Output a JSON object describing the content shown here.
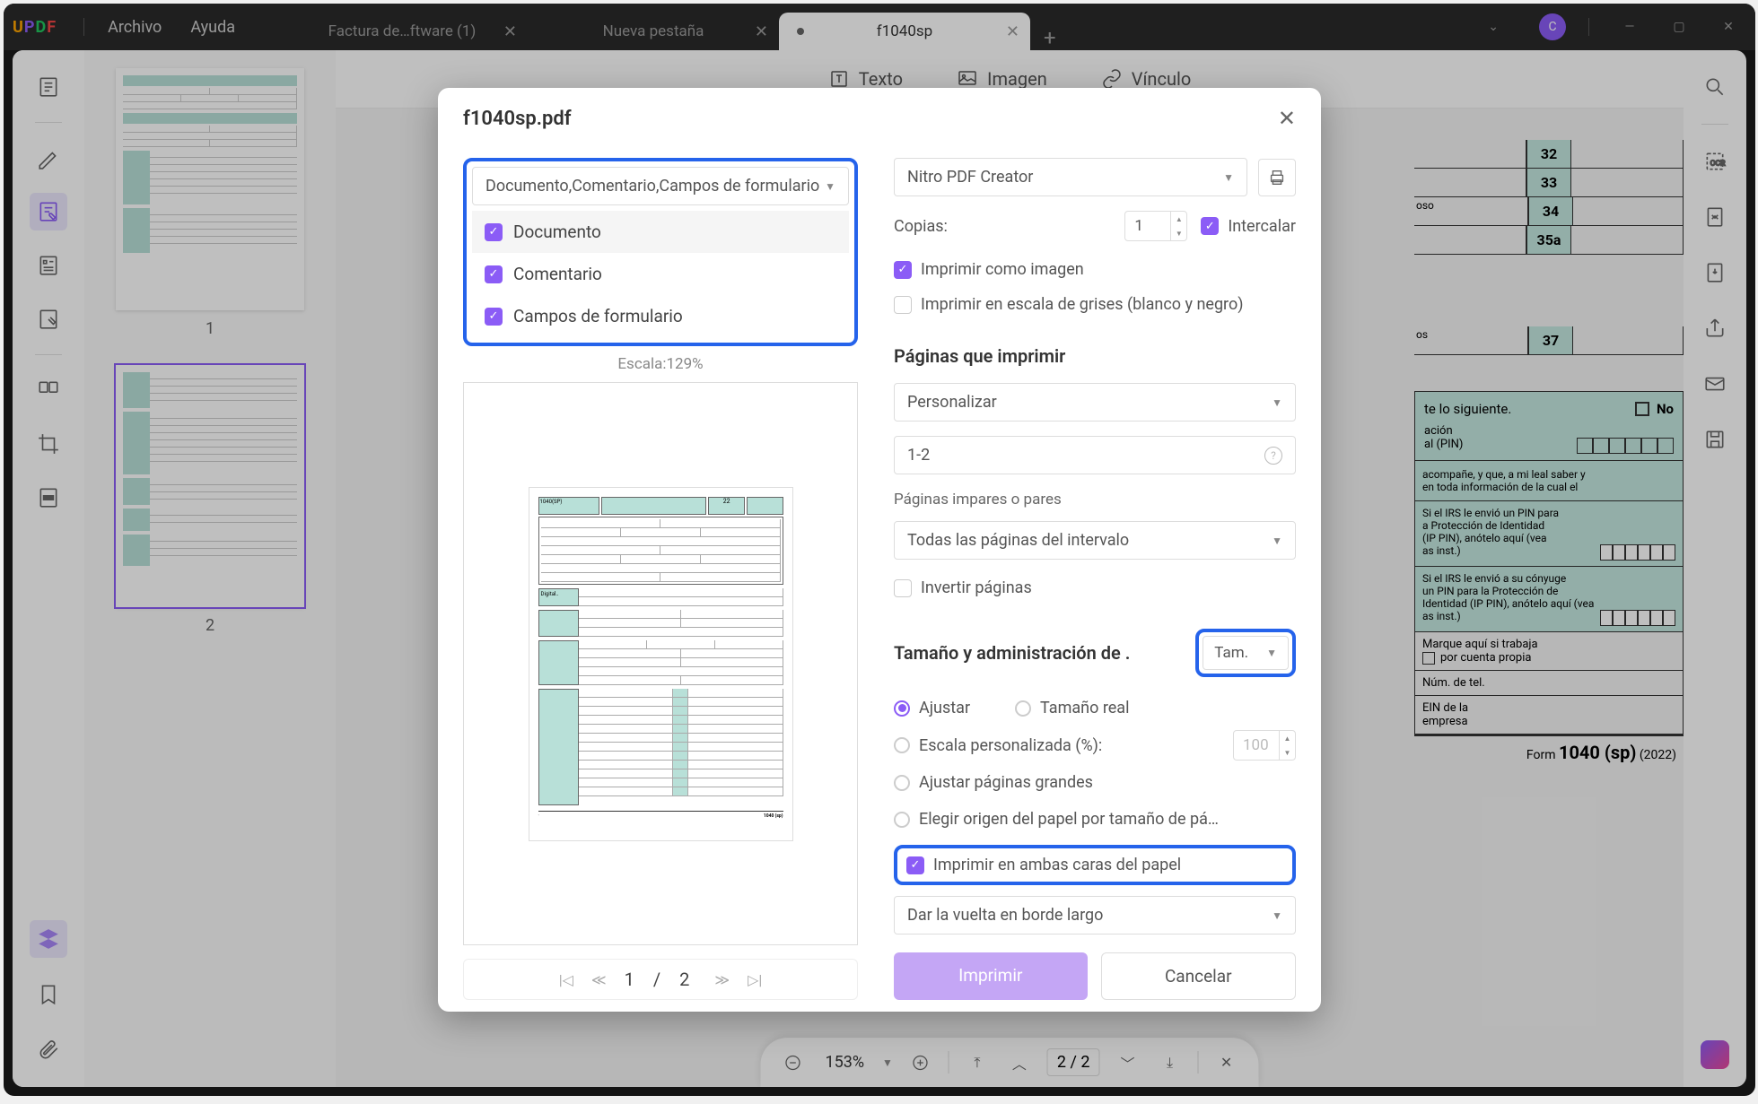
{
  "app": {
    "logoLetters": {
      "u": "U",
      "p": "P",
      "d": "D",
      "f": "F"
    },
    "menus": {
      "archivo": "Archivo",
      "ayuda": "Ayuda"
    }
  },
  "tabs": [
    {
      "label": "Factura de…ftware (1)"
    },
    {
      "label": "Nueva pestaña"
    },
    {
      "label": "f1040sp"
    }
  ],
  "avatarLetter": "C",
  "editBar": {
    "texto": "Texto",
    "imagen": "Imagen",
    "vinculo": "Vínculo"
  },
  "thumbnails": {
    "page1": "1",
    "page2": "2"
  },
  "statusBar": {
    "zoom": "153%",
    "pageDisplay": "2  /  2"
  },
  "modal": {
    "title": "f1040sp.pdf",
    "dropdown": {
      "value": "Documento,Comentario,Campos de formulario",
      "options": {
        "documento": "Documento",
        "comentario": "Comentario",
        "campos": "Campos de formulario"
      }
    },
    "scaleLabel": "Escala:129%",
    "pageNav": "1   /   2",
    "printer": "Nitro PDF Creator",
    "copiesLabel": "Copias:",
    "copiesValue": "1",
    "intercalar": "Intercalar",
    "printAsImage": "Imprimir como imagen",
    "printGrayscale": "Imprimir en escala de grises (blanco y negro)",
    "pagesHeading": "Páginas que imprimir",
    "pagesMode": "Personalizar",
    "pageRange": "1-2",
    "oddEvenLabel": "Páginas impares o pares",
    "oddEvenValue": "Todas las páginas del intervalo",
    "invertPages": "Invertir páginas",
    "sizeHeading": "Tamaño y administración de .",
    "sizeSelect": "Tam.",
    "fitRadio": "Ajustar",
    "actualRadio": "Tamaño real",
    "customScale": "Escala personalizada (%):",
    "customScaleValue": "100",
    "fitLarge": "Ajustar páginas grandes",
    "paperSource": "Elegir origen del papel por tamaño de pá…",
    "bothSides": "Imprimir en ambas caras del papel",
    "flipEdge": "Dar la vuelta en borde largo",
    "printBtn": "Imprimir",
    "cancelBtn": "Cancelar"
  },
  "form": {
    "nums": {
      "n32": "32",
      "n33": "33",
      "n34": "34",
      "n35a": "35a",
      "n37": "37"
    },
    "siguiente": "te lo siguiente.",
    "no": "No",
    "acion": "ación",
    "pin": "al (PIN)",
    "irs_line1": "Si el IRS le envió un PIN para",
    "irs_line2": "a Protección de Identidad",
    "irs_line3": "(IP PIN), anótelo aquí (vea",
    "irs_line4": "as inst.)",
    "irs2_line1": "Si el IRS le envió a su cónyuge",
    "irs2_line2": "un PIN para la Protección de",
    "irs2_line3": "Identidad (IP PIN), anótelo aquí (vea",
    "acompane": "acompañe, y que, a mi leal saber y",
    "toda_info": "en toda información de la cual el",
    "marque": "Marque aquí si trabaja",
    "cuenta": "por cuenta propia",
    "tel": "Núm. de tel.",
    "ein": "EIN de la",
    "empresa": "empresa",
    "formLabel": "Form",
    "formNum": "1040 (sp)",
    "formYear": "(2022)",
    "oso": "oso",
    "os": "os"
  }
}
